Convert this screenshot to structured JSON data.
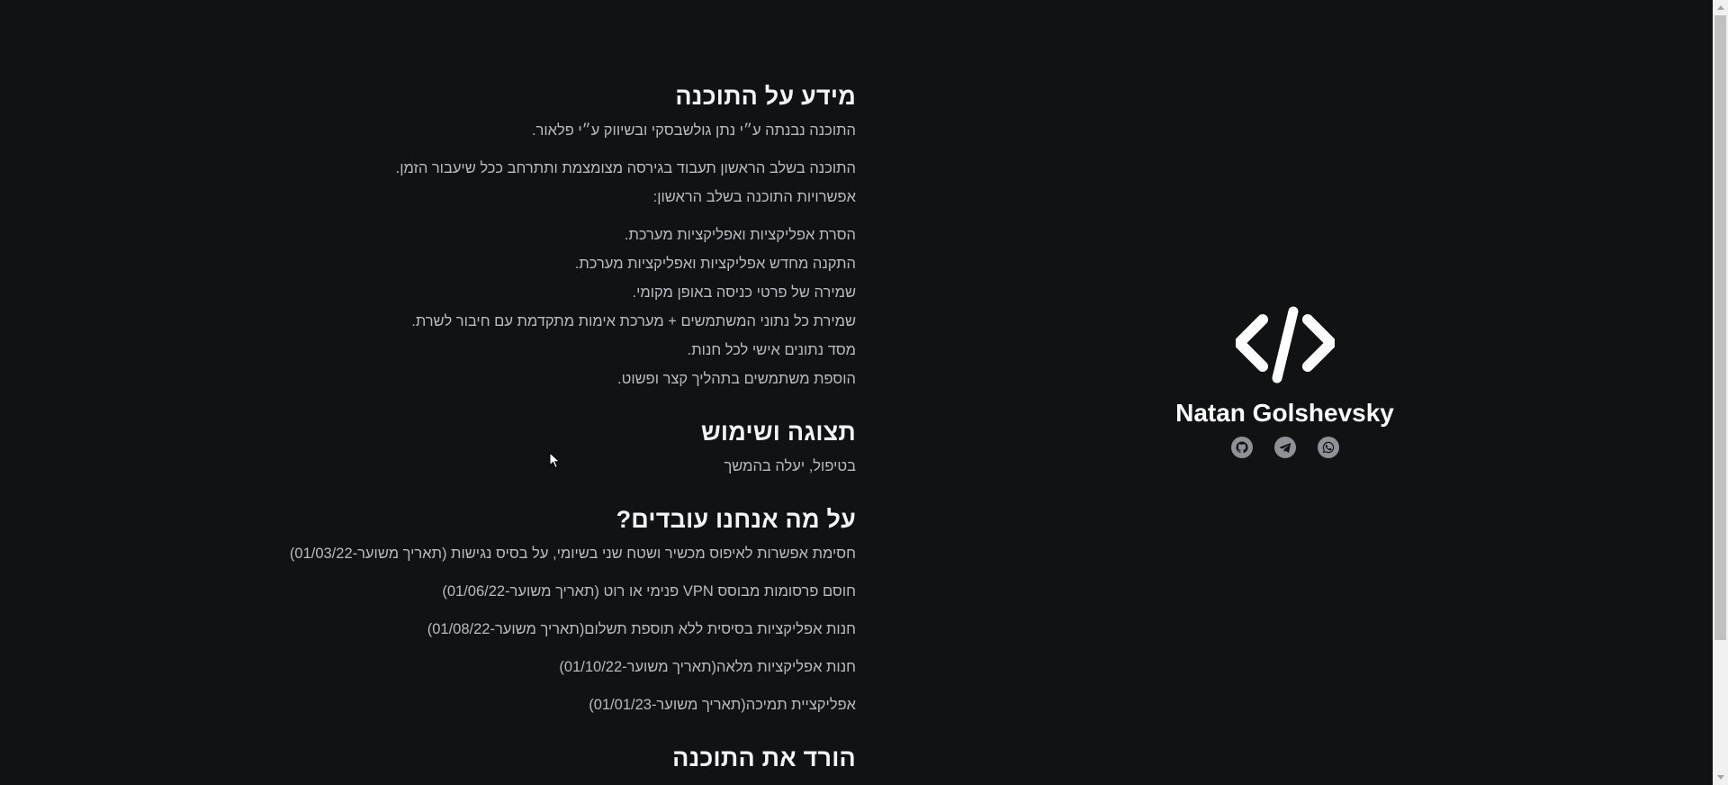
{
  "about": {
    "title": "מידע על התוכנה",
    "credit": "התוכנה נבנתה ע״י נתן גולשבסקי ובשיווק ע״י פלאור.",
    "intro_1": "התוכנה בשלב הראשון תעבוד בגירסה מצומצמת ותתרחב ככל שיעבור הזמן.",
    "intro_2": "אפשרויות התוכנה בשלב הראשון:",
    "features": [
      "הסרת אפליקציות ואפליקציות מערכת.",
      "התקנה מחדש אפליקציות ואפליקציות מערכת.",
      "שמירה של פרטי כניסה באופן מקומי.",
      "שמירת כל נתוני המשתמשים + מערכת אימות מתקדמת עם חיבור לשרת.",
      "מסד נתונים אישי לכל חנות.",
      "הוספת משתמשים בתהליך קצר ופשוט."
    ]
  },
  "display": {
    "title": "תצוגה ושימוש",
    "text": "בטיפול, יעלה בהמשך"
  },
  "working_on": {
    "title": "על מה אנחנו עובדים?",
    "items": [
      "חסימת אפשרות לאיפוס מכשיר ושטח שני בשיומי, על בסיס נגישות (תאריך משוער-01/03/22)",
      "חוסם פרסומות מבוסס VPN פנימי או רוט (תאריך משוער-01/06/22)",
      "חנות אפליקציות בסיסית ללא תוספת תשלום(תאריך משוער-01/08/22)",
      "חנות אפליקציות מלאה(תאריך משוער-01/10/22)",
      "אפליקציית תמיכה(תאריך משוער-01/01/23)"
    ]
  },
  "download": {
    "title": "הורד את התוכנה"
  },
  "profile": {
    "name": "Natan Golshevsky",
    "logo_icon": "code-icon",
    "socials": [
      "github-icon",
      "telegram-icon",
      "whatsapp-icon"
    ]
  },
  "colors": {
    "background": "#111214",
    "heading": "#f3f4f6",
    "body_text": "#b8bbc0",
    "icon": "#8e9196"
  }
}
